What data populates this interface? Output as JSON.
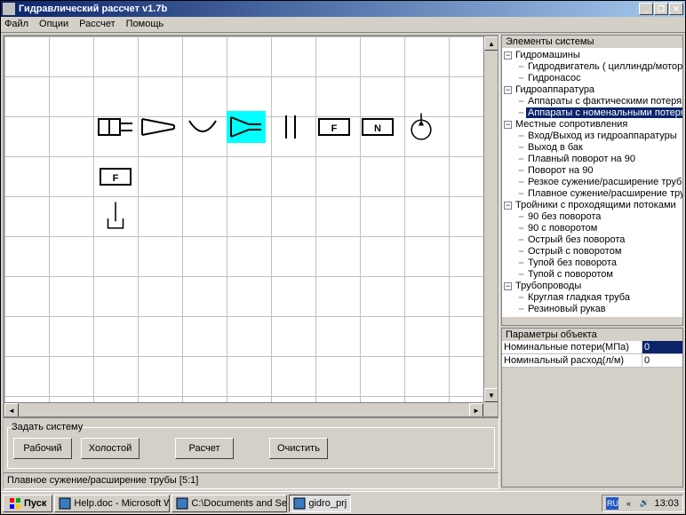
{
  "window": {
    "title": "Гидравлический рассчет v1.7b"
  },
  "menu": [
    "Файл",
    "Опции",
    "Рассчет",
    "Помощь"
  ],
  "tree": {
    "title": "Элементы системы",
    "nodes": [
      {
        "label": "Гидромашины",
        "expanded": true,
        "children": [
          {
            "label": "Гидродвигатель ( циллиндр/мотор )"
          },
          {
            "label": "Гидронасос"
          }
        ]
      },
      {
        "label": "Гидроаппаратура",
        "expanded": true,
        "children": [
          {
            "label": "Аппараты с фактическими потерями"
          },
          {
            "label": "Аппараты с номенальными потерями",
            "selected": true
          }
        ]
      },
      {
        "label": "Местные сопротивления",
        "expanded": true,
        "children": [
          {
            "label": "Вход/Выход из гидроаппаратуры"
          },
          {
            "label": "Выход в бак"
          },
          {
            "label": "Плавный поворот на 90"
          },
          {
            "label": "Поворот на 90"
          },
          {
            "label": "Резкое сужение/расширение трубы"
          },
          {
            "label": "Плавное сужение/расширение трубы"
          }
        ]
      },
      {
        "label": "Тройники с проходящими потоками",
        "expanded": true,
        "children": [
          {
            "label": "90 без поворота"
          },
          {
            "label": "90 с поворотом"
          },
          {
            "label": "Острый без поворота"
          },
          {
            "label": "Острый с поворотом"
          },
          {
            "label": "Тупой без поворота"
          },
          {
            "label": "Тупой с поворотом"
          }
        ]
      },
      {
        "label": "Трубопроводы",
        "expanded": true,
        "children": [
          {
            "label": "Круглая гладкая труба"
          },
          {
            "label": "Резиновый рукав"
          }
        ]
      }
    ]
  },
  "params": {
    "title": "Параметры объекта",
    "rows": [
      {
        "name": "Номинальные потери(МПа)",
        "value": "0",
        "highlight": true
      },
      {
        "name": "Номинальный расход(л/м)",
        "value": "0",
        "highlight": false
      }
    ]
  },
  "lower": {
    "group_title": "Задать систему",
    "btn_work": "Рабочий",
    "btn_idle": "Холостой",
    "btn_calc": "Расчет",
    "btn_clear": "Очистить"
  },
  "status": "Плавное сужение/расширение трубы [5:1]",
  "canvas_symbols": {
    "s5_letter": "F",
    "s6_letter": "N",
    "s8_letter": "F"
  },
  "taskbar": {
    "start": "Пуск",
    "tasks": [
      {
        "label": "Help.doc - Microsoft Word",
        "active": false
      },
      {
        "label": "C:\\Documents and Settin...",
        "active": false
      },
      {
        "label": "gidro_prj",
        "active": true
      }
    ],
    "lang": "RU",
    "clock": "13:03"
  }
}
